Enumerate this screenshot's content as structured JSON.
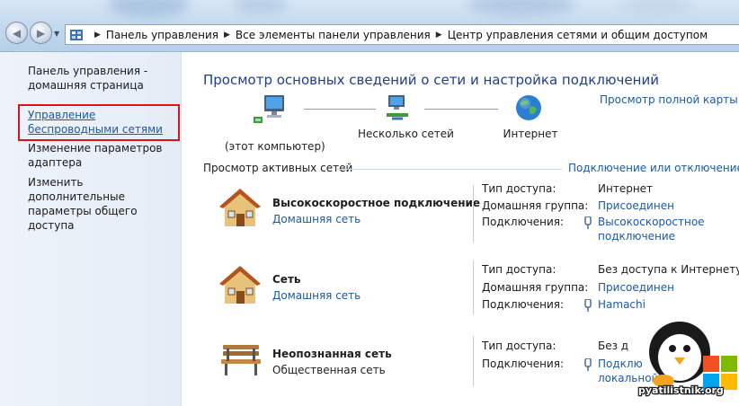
{
  "address_bar": {
    "crumbs": [
      "Панель управления",
      "Все элементы панели управления",
      "Центр управления сетями и общим доступом"
    ]
  },
  "sidebar": {
    "items": [
      {
        "label": "Панель управления - домашняя страница"
      },
      {
        "label": "Управление беспроводными сетями",
        "active": true
      },
      {
        "label": "Изменение параметров адаптера"
      },
      {
        "label": "Изменить дополнительные параметры общего доступа"
      }
    ]
  },
  "main": {
    "heading": "Просмотр основных сведений о сети и настройка подключений",
    "full_map_link": "Просмотр полной карты",
    "map": {
      "computer": "(этот компьютер)",
      "networks": "Несколько сетей",
      "internet": "Интернет"
    },
    "active_networks_title": "Просмотр активных сетей",
    "connect_disconnect_link": "Подключение или отключение",
    "labels": {
      "access_type": "Тип доступа:",
      "homegroup": "Домашняя группа:",
      "connections": "Подключения:"
    },
    "networks": [
      {
        "name": "Высокоскоростное подключение",
        "type": "Домашняя сеть",
        "icon": "house-icon",
        "access_type": "Интернет",
        "homegroup": "Присоединен",
        "connection_line1": "Высокоскоростное",
        "connection_line2": "подключение"
      },
      {
        "name": "Сеть",
        "type": "Домашняя сеть",
        "icon": "house-icon",
        "access_type": "Без доступа к Интернету",
        "homegroup": "Присоединен",
        "connection_line1": "Hamachi"
      },
      {
        "name": "Неопознанная сеть",
        "type": "Общественная сеть",
        "icon": "bench-icon",
        "access_type": "Без д",
        "connection_line1": "Подклю",
        "connection_line2": "локальной"
      }
    ]
  },
  "watermark": {
    "text": "pyatilistnik.org"
  },
  "colors": {
    "link": "#1b5aa8",
    "heading": "#1e3f8a",
    "highlight_box": "#d9151a",
    "sidebar_bg": "#e8eff8"
  }
}
